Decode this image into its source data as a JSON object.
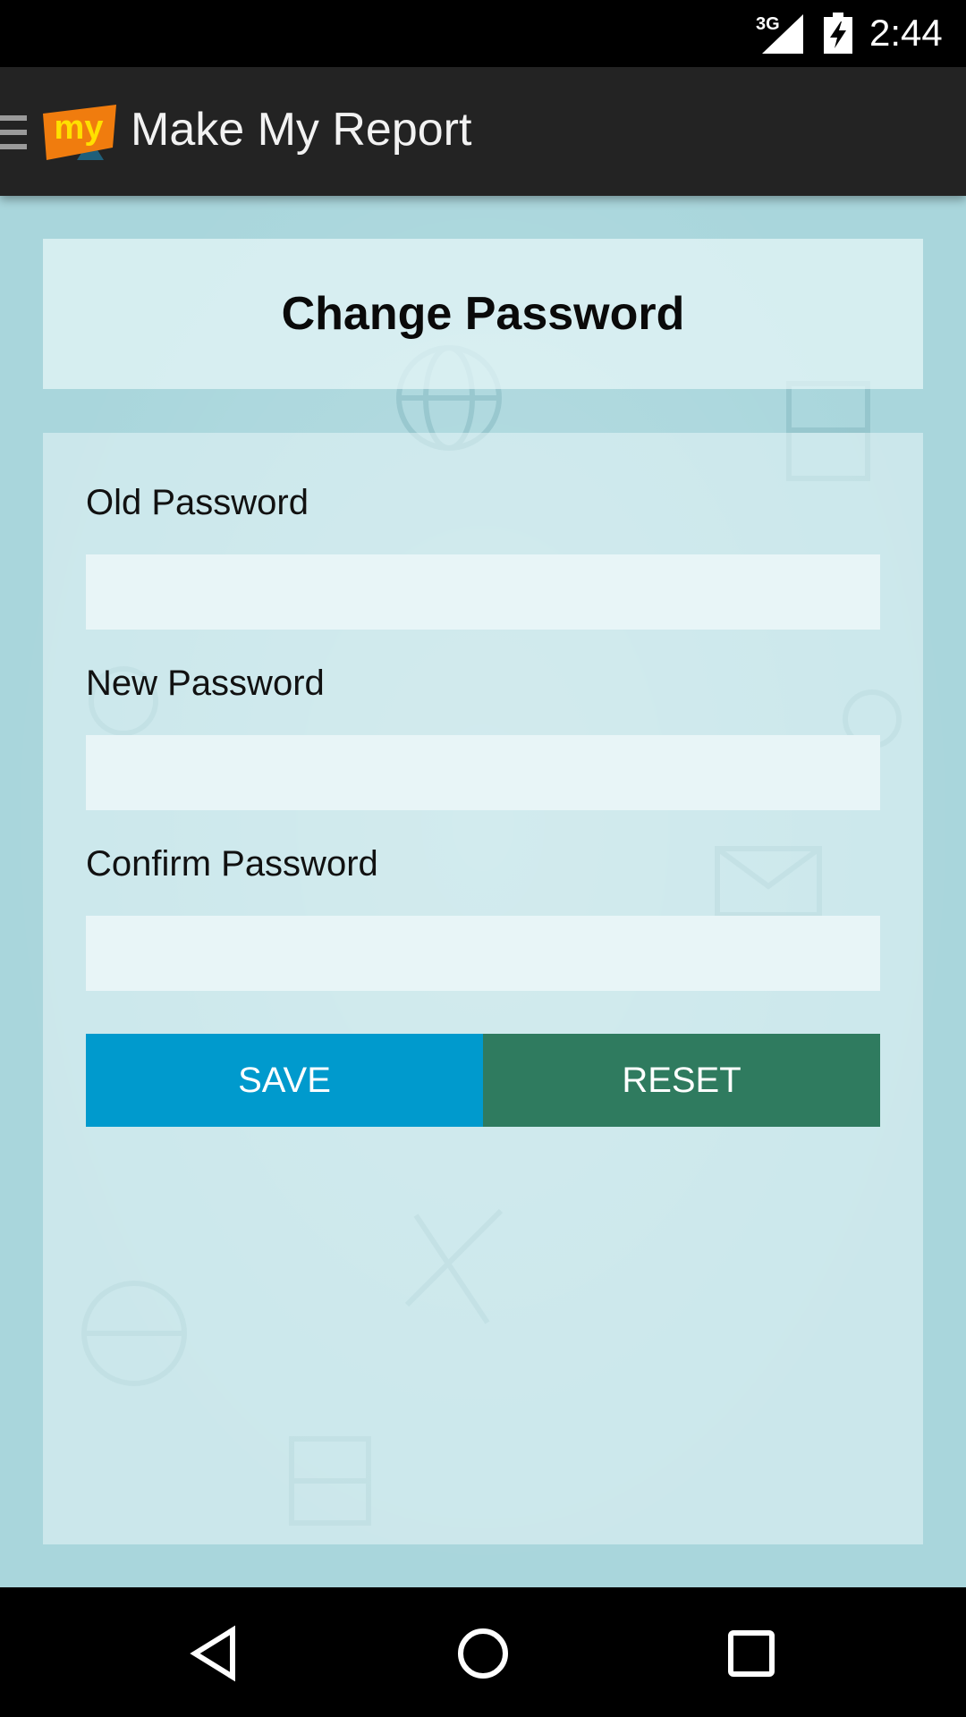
{
  "status_bar": {
    "network": "3G",
    "time": "2:44"
  },
  "app_bar": {
    "logo_text": "my",
    "title": "Make My Report"
  },
  "header": {
    "title": "Change Password"
  },
  "form": {
    "fields": [
      {
        "label": "Old Password",
        "value": "",
        "placeholder": ""
      },
      {
        "label": "New Password",
        "value": "",
        "placeholder": ""
      },
      {
        "label": "Confirm Password",
        "value": "",
        "placeholder": ""
      }
    ],
    "save_label": "SAVE",
    "reset_label": "RESET"
  },
  "colors": {
    "save": "#009acd",
    "reset": "#2f7b5f",
    "logo": "#f07c0e",
    "background": "#a9d6dc"
  },
  "icons": {
    "menu": "hamburger-icon",
    "back": "back-icon",
    "home": "home-icon",
    "recents": "recents-icon"
  }
}
